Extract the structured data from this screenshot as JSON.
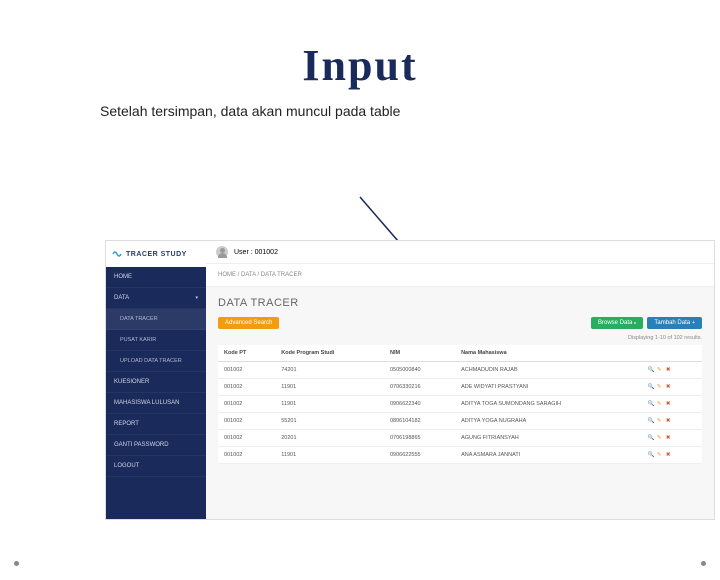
{
  "slide": {
    "title": "Input",
    "subtitle": "Setelah tersimpan, data akan muncul pada table"
  },
  "sidebar": {
    "logo": "TRACER STUDY",
    "items": [
      {
        "label": "HOME"
      },
      {
        "label": "DATA",
        "expanded": true
      },
      {
        "label": "DATA TRACER",
        "sub": true
      },
      {
        "label": "PUSAT KARIR",
        "sub": true
      },
      {
        "label": "UPLOAD DATA TRACER",
        "sub": true
      },
      {
        "label": "KUESIONER"
      },
      {
        "label": "MAHASISWA LULUSAN"
      },
      {
        "label": "REPORT"
      },
      {
        "label": "GANTI PASSWORD"
      },
      {
        "label": "LOGOUT"
      }
    ]
  },
  "topbar": {
    "user_label": "User : 001002"
  },
  "breadcrumb": "HOME  /  DATA  /  DATA TRACER",
  "page": {
    "heading": "DATA TRACER",
    "adv_search": "Advanced Search",
    "browse": "Browse Data",
    "tambah": "Tambah Data",
    "result_count": "Displaying 1-10 of 102 results."
  },
  "table": {
    "headers": [
      "Kode PT",
      "Kode Program Studi",
      "NIM",
      "Nama Mahasiswa",
      ""
    ],
    "rows": [
      {
        "cells": [
          "001002",
          "74201",
          "0505000840",
          "ACHMADUDIN RAJAB"
        ]
      },
      {
        "cells": [
          "001002",
          "11901",
          "0706330216",
          "ADE WIDYATI PRASTYANI"
        ]
      },
      {
        "cells": [
          "001002",
          "11901",
          "0906622340",
          "ADITYA TOGA SUMONDANG SARAGIH"
        ]
      },
      {
        "cells": [
          "001002",
          "55201",
          "0806104182",
          "ADITYA YOGA NUGRAHA"
        ]
      },
      {
        "cells": [
          "001002",
          "20201",
          "0706198865",
          "AGUNG FITRIANSYAH"
        ]
      },
      {
        "cells": [
          "001002",
          "11901",
          "0906622555",
          "ANA ASMARA JANNATI"
        ]
      }
    ]
  }
}
